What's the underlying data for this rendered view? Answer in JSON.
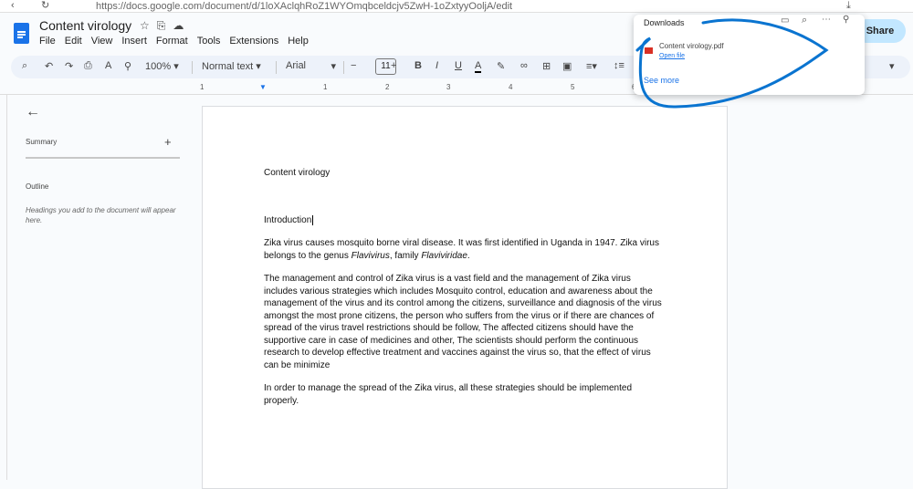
{
  "browser": {
    "url": "https://docs.google.com/document/d/1loXAclqhRoZ1WYOmqbceldcjv5ZwH-1oZxtyyOoljA/edit"
  },
  "doc": {
    "title": "Content virology",
    "menu": [
      "File",
      "Edit",
      "View",
      "Insert",
      "Format",
      "Tools",
      "Extensions",
      "Help"
    ]
  },
  "toolbar": {
    "zoom": "100%",
    "style": "Normal text",
    "font": "Arial",
    "font_size": "11"
  },
  "ruler": [
    "1",
    "1",
    "2",
    "3",
    "4",
    "5",
    "6"
  ],
  "sidebar": {
    "summary": "Summary",
    "outline": "Outline",
    "outline_hint": "Headings you add to the document will appear here."
  },
  "share": "Share",
  "downloads": {
    "title": "Downloads",
    "file": "Content virology.pdf",
    "open": "Open file",
    "see_more": "See more"
  },
  "body": {
    "heading": "Content virology",
    "intro": "Introduction",
    "p1a": "Zika virus causes mosquito borne viral disease. It was first identified in Uganda in 1947. Zika virus belongs to the genus ",
    "p1b": "Flavivirus",
    "p1c": ", family ",
    "p1d": "Flaviviridae",
    "p2": "The management and control of Zika virus is a vast field and the management of Zika virus includes various strategies which includes Mosquito control, education and awareness about the management of the virus and its control among the citizens, surveillance and diagnosis of the virus amongst the most prone citizens, the person who suffers from the virus or if there are chances of spread of the virus travel restrictions should be follow, The affected citizens should have the supportive care in case of medicines and other, The scientists should perform the continuous research to develop effective treatment and vaccines against the virus so, that the effect of virus can be minimize",
    "p3": "In order to manage the spread of the Zika virus, all these strategies should be implemented properly."
  },
  "annotation_color": "#0a74d0"
}
